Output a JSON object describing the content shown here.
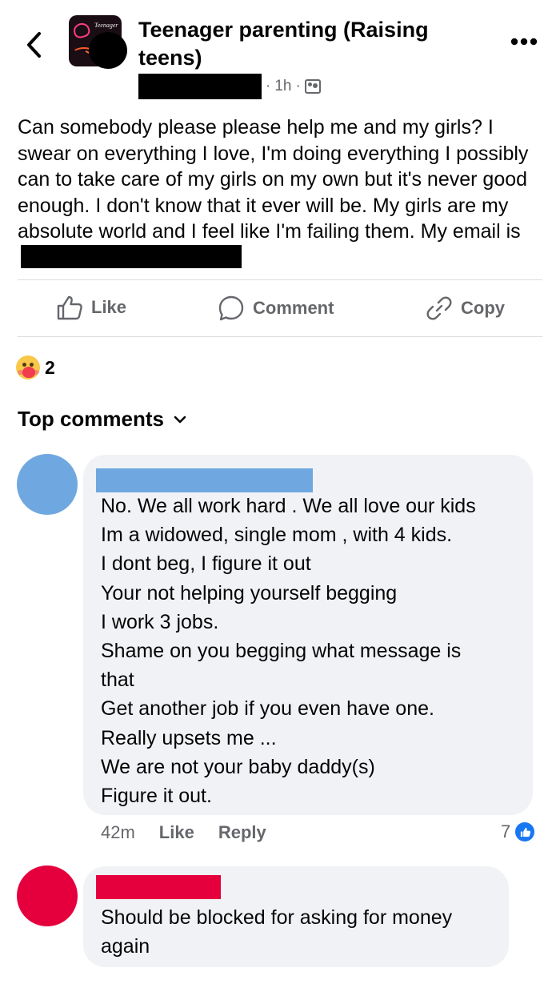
{
  "header": {
    "back_icon": "chevron-left-icon",
    "group_name": "Teenager parenting (Raising teens)",
    "avatar_text": "Teenager",
    "time": "1h",
    "separator": "·",
    "audience_icon": "group-icon",
    "more_icon": "more-horizontal-icon"
  },
  "post": {
    "text": "Can somebody please please help me and my girls? I swear on everything I love, I'm doing everything I possibly can to take care of my girls on my own but it's never good enough. I don't know that it ever will be. My girls are my absolute world and I feel like I'm failing them. My email is"
  },
  "actions": {
    "like": "Like",
    "comment": "Comment",
    "copy": "Copy"
  },
  "reactions": {
    "icon": "care-emoji-icon",
    "count": "2"
  },
  "comments_section": {
    "title": "Top comments",
    "sort_icon": "chevron-down-icon"
  },
  "comments": [
    {
      "avatar_color": "#6fa8e0",
      "name_redaction_color": "#6fa8e0",
      "text": "No. We all work hard  . We all love our kids\nIm a widowed, single mom , with 4 kids.\nI dont beg, I figure it out\nYour not helping yourself begging\nI work 3 jobs.\nShame on you begging what message is\nthat\nGet another job if you even have one.\nReally upsets me ...\nWe are not your baby daddy(s)\nFigure it out.",
      "time": "42m",
      "like": "Like",
      "reply": "Reply",
      "like_count": "7"
    },
    {
      "avatar_color": "#e5003d",
      "name_redaction_color": "#e5003d",
      "text": "Should be blocked for asking for money\nagain"
    }
  ],
  "colors": {
    "secondary_text": "#65676b",
    "bubble": "#f0f2f5",
    "like_blue": "#1877f2"
  }
}
